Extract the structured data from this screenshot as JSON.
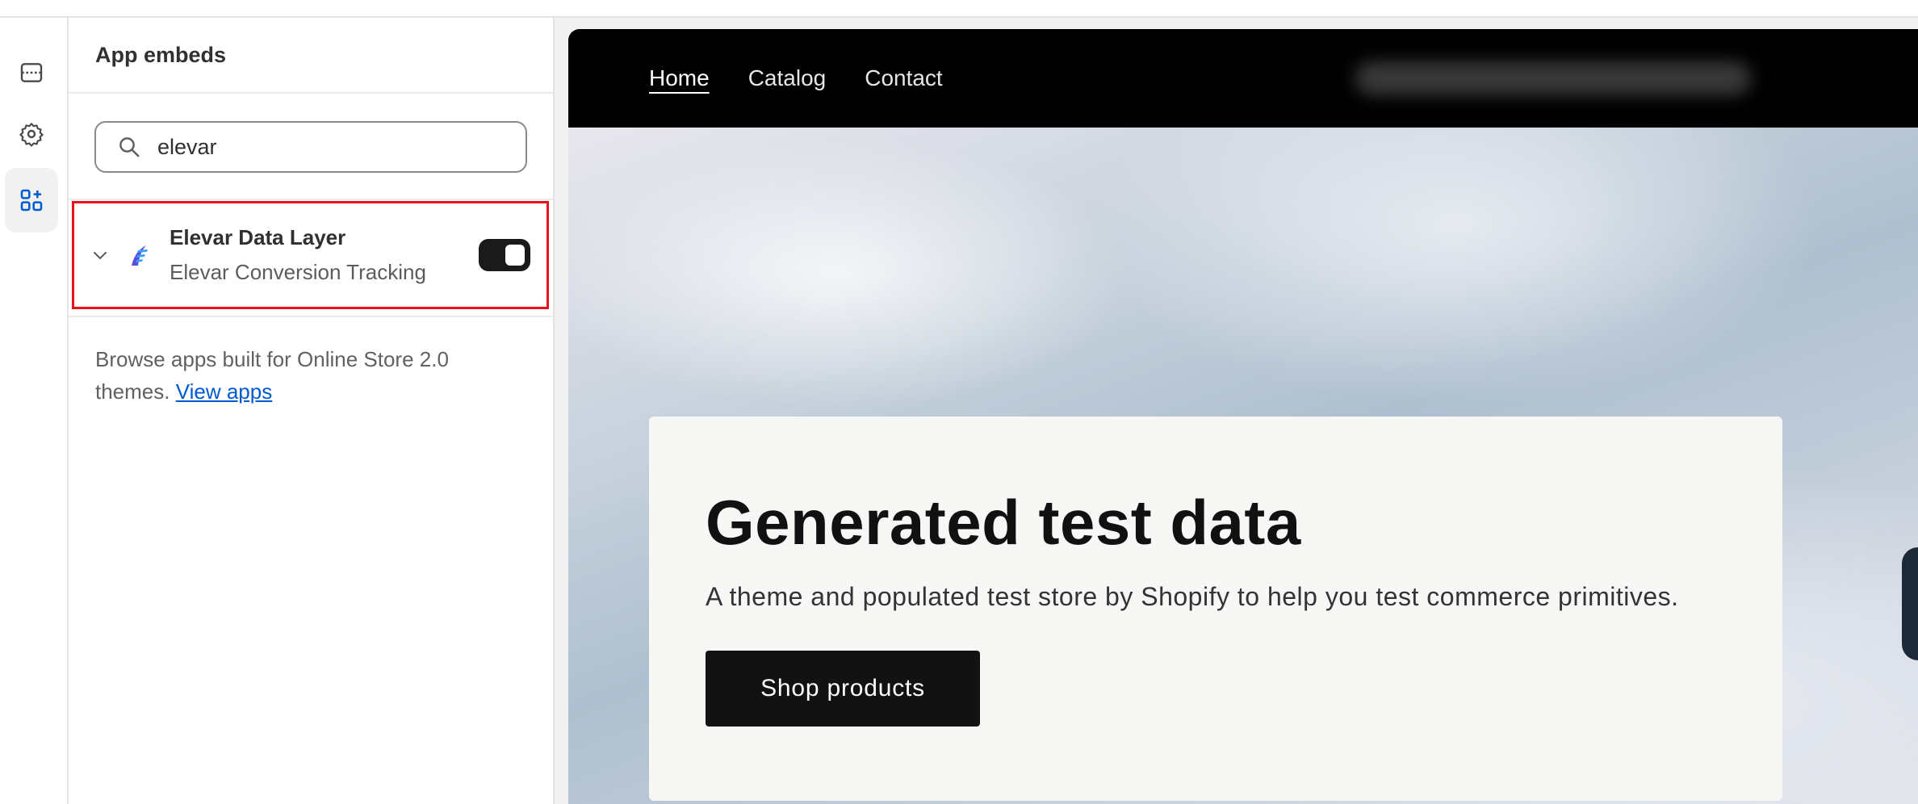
{
  "sidebar_rail": {
    "items": [
      {
        "icon": "sections-icon"
      },
      {
        "icon": "gear-icon"
      },
      {
        "icon": "app-embed-icon",
        "active": true
      }
    ]
  },
  "panel": {
    "title": "App embeds",
    "search": {
      "value": "elevar",
      "placeholder": "Search"
    },
    "embed": {
      "name": "Elevar Data Layer",
      "subtitle": "Elevar Conversion Tracking",
      "enabled": true
    },
    "browse_text": "Browse apps built for Online Store 2.0 themes.",
    "browse_link": "View apps"
  },
  "store": {
    "nav": [
      "Home",
      "Catalog",
      "Contact"
    ],
    "hero_title": "Generated test data",
    "hero_subtitle": "A theme and populated test store by Shopify to help you test commerce primitives.",
    "hero_button": "Shop products"
  },
  "colors": {
    "accent": "#005bd3",
    "highlight": "#e5141c",
    "toggle_on": "#1a1a1a"
  }
}
